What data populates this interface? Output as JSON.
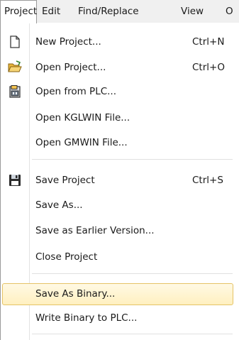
{
  "menubar": {
    "items": [
      {
        "label": "Project"
      },
      {
        "label": "Edit"
      },
      {
        "label": "Find/Replace"
      },
      {
        "label": "View"
      },
      {
        "label": "O"
      }
    ]
  },
  "project_menu": {
    "items": [
      {
        "label": "New Project...",
        "shortcut": "Ctrl+N",
        "icon": "new-document-icon"
      },
      {
        "label": "Open Project...",
        "shortcut": "Ctrl+O",
        "icon": "open-folder-icon"
      },
      {
        "label": "Open from PLC...",
        "shortcut": "",
        "icon": "open-from-plc-icon"
      },
      {
        "label": "Open KGLWIN File...",
        "shortcut": ""
      },
      {
        "label": "Open GMWIN File...",
        "shortcut": ""
      },
      {
        "label": "Save Project",
        "shortcut": "Ctrl+S",
        "icon": "floppy-disk-icon"
      },
      {
        "label": "Save As...",
        "shortcut": ""
      },
      {
        "label": "Save as Earlier Version...",
        "shortcut": ""
      },
      {
        "label": "Close Project",
        "shortcut": ""
      },
      {
        "label": "Save As Binary...",
        "shortcut": "",
        "highlighted": true
      },
      {
        "label": "Write Binary to PLC...",
        "shortcut": ""
      }
    ]
  },
  "colors": {
    "menubar_bg": "#f0f0f0",
    "highlight_bg": "#fff3cd",
    "highlight_border": "#e5c365"
  }
}
